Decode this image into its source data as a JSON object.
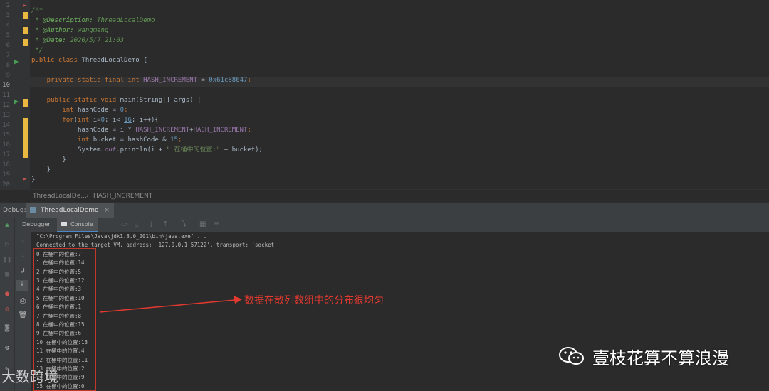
{
  "editor": {
    "line_numbers": [
      "2",
      "3",
      "4",
      "5",
      "6",
      "7",
      "8",
      "9",
      "10",
      "11",
      "12",
      "13",
      "14",
      "15",
      "16",
      "17",
      "18",
      "19",
      "20"
    ],
    "code": {
      "l2": "/**",
      "l3_prefix": " * ",
      "l3_tag": "@Description:",
      "l3_text": " ThreadLocalDemo",
      "l4_prefix": " * ",
      "l4_tag": "@Author:",
      "l4_text": " wangmeng",
      "l5_prefix": " * ",
      "l5_tag": "@Date:",
      "l5_text": " 2020/5/7 21:03",
      "l6": " */",
      "l7_kw": "public class ",
      "l7_name": "ThreadLocalDemo {",
      "l9_kw": "    private static final int ",
      "l9_field": "HASH_INCREMENT",
      "l9_eq": " = ",
      "l9_num": "0x61c88647",
      "l9_end": ";",
      "l11_kw": "    public static void ",
      "l11_rest": "main(String[] args) {",
      "l12_kw": "        int ",
      "l12_mid": "hashCode = ",
      "l12_num": "0",
      "l12_end": ";",
      "l13_kw": "        for",
      "l13_a": "(",
      "l13_kw2": "int ",
      "l13_b": "i=",
      "l13_num0": "0",
      "l13_c": "; i< ",
      "l13_num16": "16",
      "l13_d": "; i++){",
      "l14_a": "            hashCode = i * ",
      "l14_f1": "HASH_INCREMENT",
      "l14_plus": "+",
      "l14_f2": "HASH_INCREMENT",
      "l14_end": ";",
      "l15_kw": "            int ",
      "l15_mid": "bucket = hashCode & ",
      "l15_num": "15",
      "l15_end": ";",
      "l16_a": "            System.",
      "l16_out": "out",
      "l16_b": ".println(i + ",
      "l16_str": "\" 在桶中的位置:\"",
      "l16_c": " + bucket);",
      "l17": "        }",
      "l18": "    }",
      "l19": "}"
    }
  },
  "breadcrumb": {
    "class": "ThreadLocalDe...",
    "sep": "›",
    "field": "HASH_INCREMENT"
  },
  "debug": {
    "label": "Debug:",
    "tab_title": "ThreadLocalDemo",
    "tab_close": "×",
    "subtabs": {
      "debugger": "Debugger",
      "console": "Console"
    }
  },
  "console": {
    "lines": [
      "\"C:\\Program Files\\Java\\jdk1.8.0_201\\bin\\java.exe\" ...",
      "Connected to the target VM, address: '127.0.0.1:57122', transport: 'socket'",
      "0 在桶中的位置:7",
      "1 在桶中的位置:14",
      "2 在桶中的位置:5",
      "3 在桶中的位置:12",
      "4 在桶中的位置:3",
      "5 在桶中的位置:10",
      "6 在桶中的位置:1",
      "7 在桶中的位置:8",
      "8 在桶中的位置:15",
      "9 在桶中的位置:6",
      "10 在桶中的位置:13",
      "11 在桶中的位置:4",
      "12 在桶中的位置:11",
      "13 在桶中的位置:2",
      "14 在桶中的位置:9",
      "15 在桶中的位置:0"
    ]
  },
  "annotation": {
    "text": "数据在散列数组中的分布很均匀",
    "color": "#e5392f"
  },
  "watermark": {
    "account": "壹枝花算不算浪漫",
    "site": "大数跨境"
  }
}
